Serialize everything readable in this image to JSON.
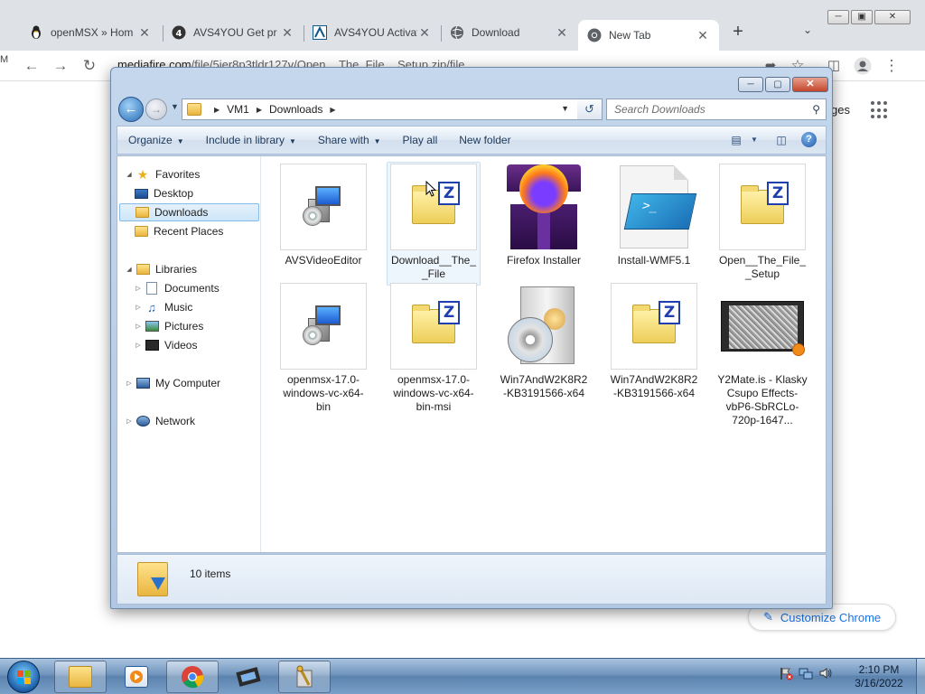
{
  "browser": {
    "tabs": [
      {
        "title": "openMSX » Hom",
        "icon": "penguin-icon"
      },
      {
        "title": "AVS4YOU Get pr",
        "icon": "avs-4-icon"
      },
      {
        "title": "AVS4YOU Activat",
        "icon": "avs-logo-icon"
      },
      {
        "title": "Download",
        "icon": "globe-icon"
      },
      {
        "title": "New Tab",
        "icon": "chrome-icon"
      }
    ],
    "tab_close_glyph": "✕",
    "new_tab_glyph": "+",
    "tab_list_glyph": "⌄",
    "url_host": "mediafire.com",
    "url_path": "/file/5ier8p3tldr127v/Open__The_File__Setup.zip/file",
    "ntp_partial_text": "ges",
    "customize_label": "Customize Chrome",
    "left_stub": "M"
  },
  "explorer": {
    "breadcrumb": [
      "VM1",
      "Downloads"
    ],
    "search_placeholder": "Search Downloads",
    "commands": [
      {
        "label": "Organize",
        "dropdown": true
      },
      {
        "label": "Include in library",
        "dropdown": true
      },
      {
        "label": "Share with",
        "dropdown": true
      },
      {
        "label": "Play all",
        "dropdown": false
      },
      {
        "label": "New folder",
        "dropdown": false
      }
    ],
    "nav": {
      "favorites": "Favorites",
      "desktop": "Desktop",
      "downloads": "Downloads",
      "recent": "Recent Places",
      "libraries": "Libraries",
      "documents": "Documents",
      "music": "Music",
      "pictures": "Pictures",
      "videos": "Videos",
      "computer": "My Computer",
      "network": "Network"
    },
    "files": [
      {
        "name": "AVSVideoEditor",
        "kind": "installer"
      },
      {
        "name": "Download__The__File",
        "kind": "zip"
      },
      {
        "name": "Firefox Installer",
        "kind": "firefox"
      },
      {
        "name": "Install-WMF5.1",
        "kind": "powershell"
      },
      {
        "name": "Open__The_File__Setup",
        "kind": "zip"
      },
      {
        "name": "openmsx-17.0-windows-vc-x64-bin",
        "kind": "installer"
      },
      {
        "name": "openmsx-17.0-windows-vc-x64-bin-msi",
        "kind": "zip"
      },
      {
        "name": "Win7AndW2K8R2-KB3191566-x64",
        "kind": "cdbox"
      },
      {
        "name": "Win7AndW2K8R2-KB3191566-x64",
        "kind": "zip"
      },
      {
        "name": "Y2Mate.is - Klasky Csupo Effects-vbP6-SbRCLo-720p-1647...",
        "kind": "video"
      }
    ],
    "item_count": "10 items"
  },
  "taskbar": {
    "apps": [
      "explorer-icon",
      "media-player-icon",
      "chrome-icon",
      "movie-maker-icon",
      "setup-tool-icon"
    ],
    "time": "2:10 PM",
    "date": "3/16/2022"
  },
  "colors": {
    "chrome_tabstrip": "#dee1e6",
    "explorer_frame": "#c4d7ec",
    "taskbar": "#6f94bd",
    "selection": "#cde6f9",
    "link_blue": "#1a73e8"
  }
}
